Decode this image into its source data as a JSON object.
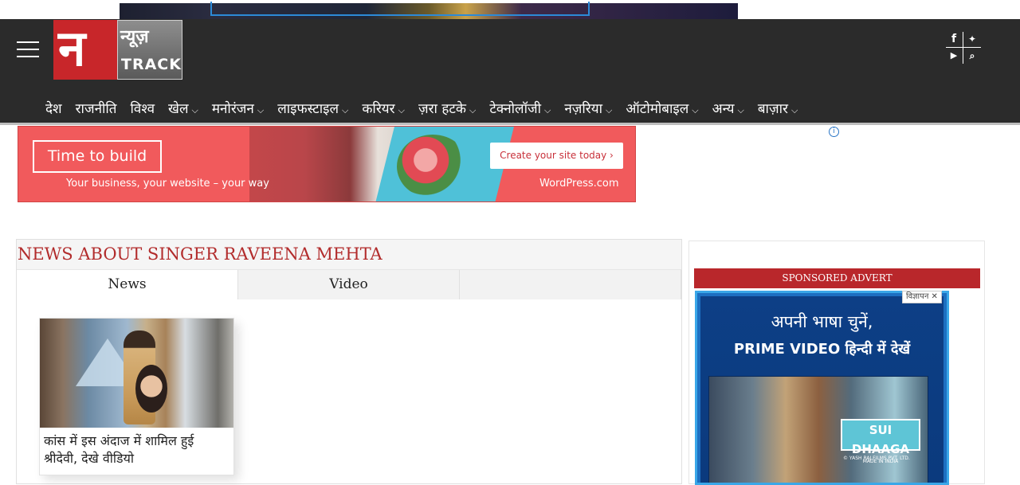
{
  "header": {
    "logo": {
      "mark": "न",
      "hindi": "न्यूज़",
      "english": "TRACK"
    },
    "nav": [
      {
        "label": "देश",
        "dropdown": false
      },
      {
        "label": "राजनीति",
        "dropdown": false
      },
      {
        "label": "विश्व",
        "dropdown": false
      },
      {
        "label": "खेल",
        "dropdown": true
      },
      {
        "label": "मनोरंजन",
        "dropdown": true
      },
      {
        "label": "लाइफस्टाइल",
        "dropdown": true
      },
      {
        "label": "करियर",
        "dropdown": true
      },
      {
        "label": "ज़रा हटके",
        "dropdown": true
      },
      {
        "label": "टेक्नोलॉजी",
        "dropdown": true
      },
      {
        "label": "नज़रिया",
        "dropdown": true
      },
      {
        "label": "ऑटोमोबाइल",
        "dropdown": true
      },
      {
        "label": "अन्य",
        "dropdown": true
      },
      {
        "label": "बाज़ार",
        "dropdown": true
      }
    ],
    "social": {
      "facebook": "f",
      "twitter": "🐦",
      "youtube": "▶",
      "search": "🔍"
    },
    "chevron": "⌵"
  },
  "wp_ad": {
    "headline": "Time to build",
    "subline": "Your business, your website – your way",
    "cta": "Create your site today ›",
    "brand": "WordPress.com",
    "info": "i"
  },
  "news": {
    "heading": "NEWS ABOUT SINGER RAVEENA MEHTA",
    "tabs": [
      "News",
      "Video",
      ""
    ],
    "cards": [
      {
        "caption": "कांस में इस अंदाज में शामिल हुई श्रीदेवी, देखे वीडियो"
      }
    ]
  },
  "sidebar": {
    "label": "SPONSORED ADVERT",
    "ad": {
      "line1": "अपनी भाषा चुनें,",
      "line2": "PRIME VIDEO हिन्दी में देखें",
      "movie_title": "SUI DHAAGA",
      "movie_sub": "MADE IN INDIA",
      "studio": "© YASH RAJ FILMS PVT. LTD.",
      "tag": "विज्ञापन ✕"
    }
  },
  "colors": {
    "header_bg": "#2b2b2b",
    "accent_red": "#b9272b",
    "wp_coral": "#f15a5c"
  }
}
